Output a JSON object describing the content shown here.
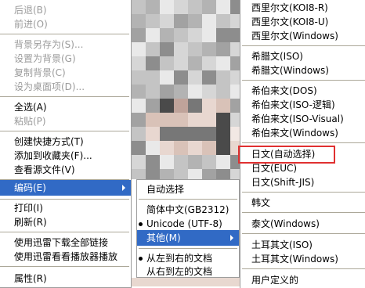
{
  "context_menu": {
    "back": "后退(B)",
    "forward": "前进(O)",
    "save_bg": "背景另存为(S)...",
    "set_bg": "设置为背景(G)",
    "copy_bg": "复制背景(C)",
    "set_desktop": "设为桌面项(D)...",
    "select_all": "全选(A)",
    "paste": "粘贴(P)",
    "create_shortcut": "创建快捷方式(T)",
    "add_fav": "添加到收藏夹(F)...",
    "view_source": "查看源文件(V)",
    "encoding": "编码(E)",
    "print": "打印(I)",
    "refresh": "刷新(R)",
    "xunlei_all": "使用迅雷下载全部链接",
    "xunlei_player": "使用迅雷看看播放器播放",
    "properties": "属性(R)"
  },
  "encoding_menu": {
    "auto": "自动选择",
    "gb2312": "简体中文(GB2312)",
    "utf8": "Unicode (UTF-8)",
    "other": "其他(M)",
    "ltr": "从左到右的文档",
    "rtl": "从右到左的文档"
  },
  "other_menu": {
    "items": [
      "西里尔文(KOI8-R)",
      "西里尔文(KOI8-U)",
      "西里尔文(Windows)",
      "希腊文(ISO)",
      "希腊文(Windows)",
      "希伯来文(DOS)",
      "希伯来文(ISO-逻辑)",
      "希伯来文(ISO-Visual)",
      "希伯来文(Windows)",
      "日文(自动选择)",
      "日文(EUC)",
      "日文(Shift-JIS)",
      "韩文",
      "泰文(Windows)",
      "土耳其文(ISO)",
      "土耳其文(Windows)",
      "用户定义的"
    ]
  },
  "colors": {
    "highlight_bg": "#316ac5",
    "annotation_box": "#e03030",
    "disabled_text": "#9b9b9b"
  }
}
